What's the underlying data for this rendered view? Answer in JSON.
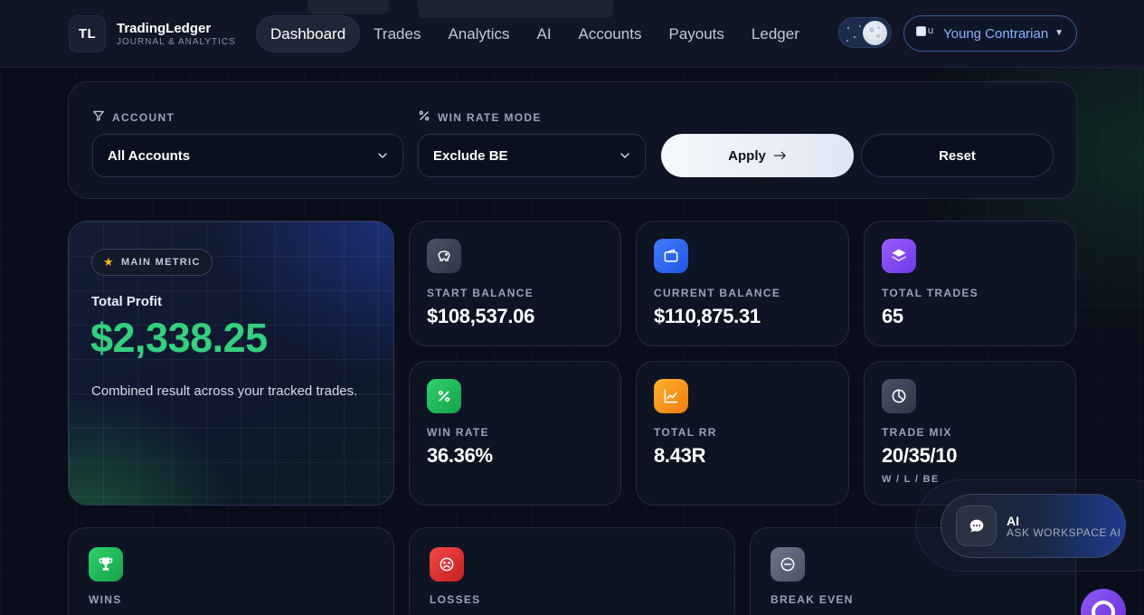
{
  "brand": {
    "logo": "TL",
    "name": "TradingLedger",
    "subtitle": "JOURNAL & ANALYTICS"
  },
  "nav": [
    {
      "label": "Dashboard",
      "active": true
    },
    {
      "label": "Trades"
    },
    {
      "label": "Analytics"
    },
    {
      "label": "AI"
    },
    {
      "label": "Accounts"
    },
    {
      "label": "Payouts"
    },
    {
      "label": "Ledger"
    }
  ],
  "theme_toggle": {
    "mode": "dark",
    "icon": "moon-icon"
  },
  "user": {
    "avatar_alt": "u",
    "name": "Young Contrarian",
    "icon": "caret-down-icon"
  },
  "filters": {
    "account_label": "ACCOUNT",
    "account_icon": "filter-icon",
    "account_value": "All Accounts",
    "winrate_label": "WIN RATE MODE",
    "winrate_icon": "percent-icon",
    "winrate_value": "Exclude BE",
    "apply_label": "Apply",
    "reset_label": "Reset"
  },
  "hero": {
    "badge": "MAIN METRIC",
    "title": "Total Profit",
    "value": "$2,338.25",
    "description": "Combined result across your tracked trades.",
    "value_color": "#35d07f"
  },
  "stats": {
    "start_balance": {
      "label": "START BALANCE",
      "value": "$108,537.06",
      "icon": "piggy-bank-icon"
    },
    "current_balance": {
      "label": "CURRENT BALANCE",
      "value": "$110,875.31",
      "icon": "wallet-icon"
    },
    "total_trades": {
      "label": "TOTAL TRADES",
      "value": "65",
      "icon": "layers-icon"
    },
    "win_rate": {
      "label": "WIN RATE",
      "value": "36.36%",
      "icon": "percent-icon"
    },
    "total_rr": {
      "label": "TOTAL RR",
      "value": "8.43R",
      "icon": "trend-chart-icon"
    },
    "trade_mix": {
      "label": "TRADE MIX",
      "value": "20/35/10",
      "sub": "W / L / BE",
      "icon": "pie-chart-icon"
    }
  },
  "outcomes": {
    "wins": {
      "label": "WINS",
      "icon": "trophy-icon"
    },
    "losses": {
      "label": "LOSSES",
      "icon": "sad-face-icon"
    },
    "break_even": {
      "label": "BREAK EVEN",
      "icon": "minus-circle-icon"
    }
  },
  "ai_widget": {
    "title": "AI",
    "subtitle": "ASK WORKSPACE AI",
    "icon": "chat-bubble-icon"
  },
  "colors": {
    "background": "#0a0e1a",
    "accent_profit": "#35d07f",
    "user_accent": "#8cb2ff"
  }
}
